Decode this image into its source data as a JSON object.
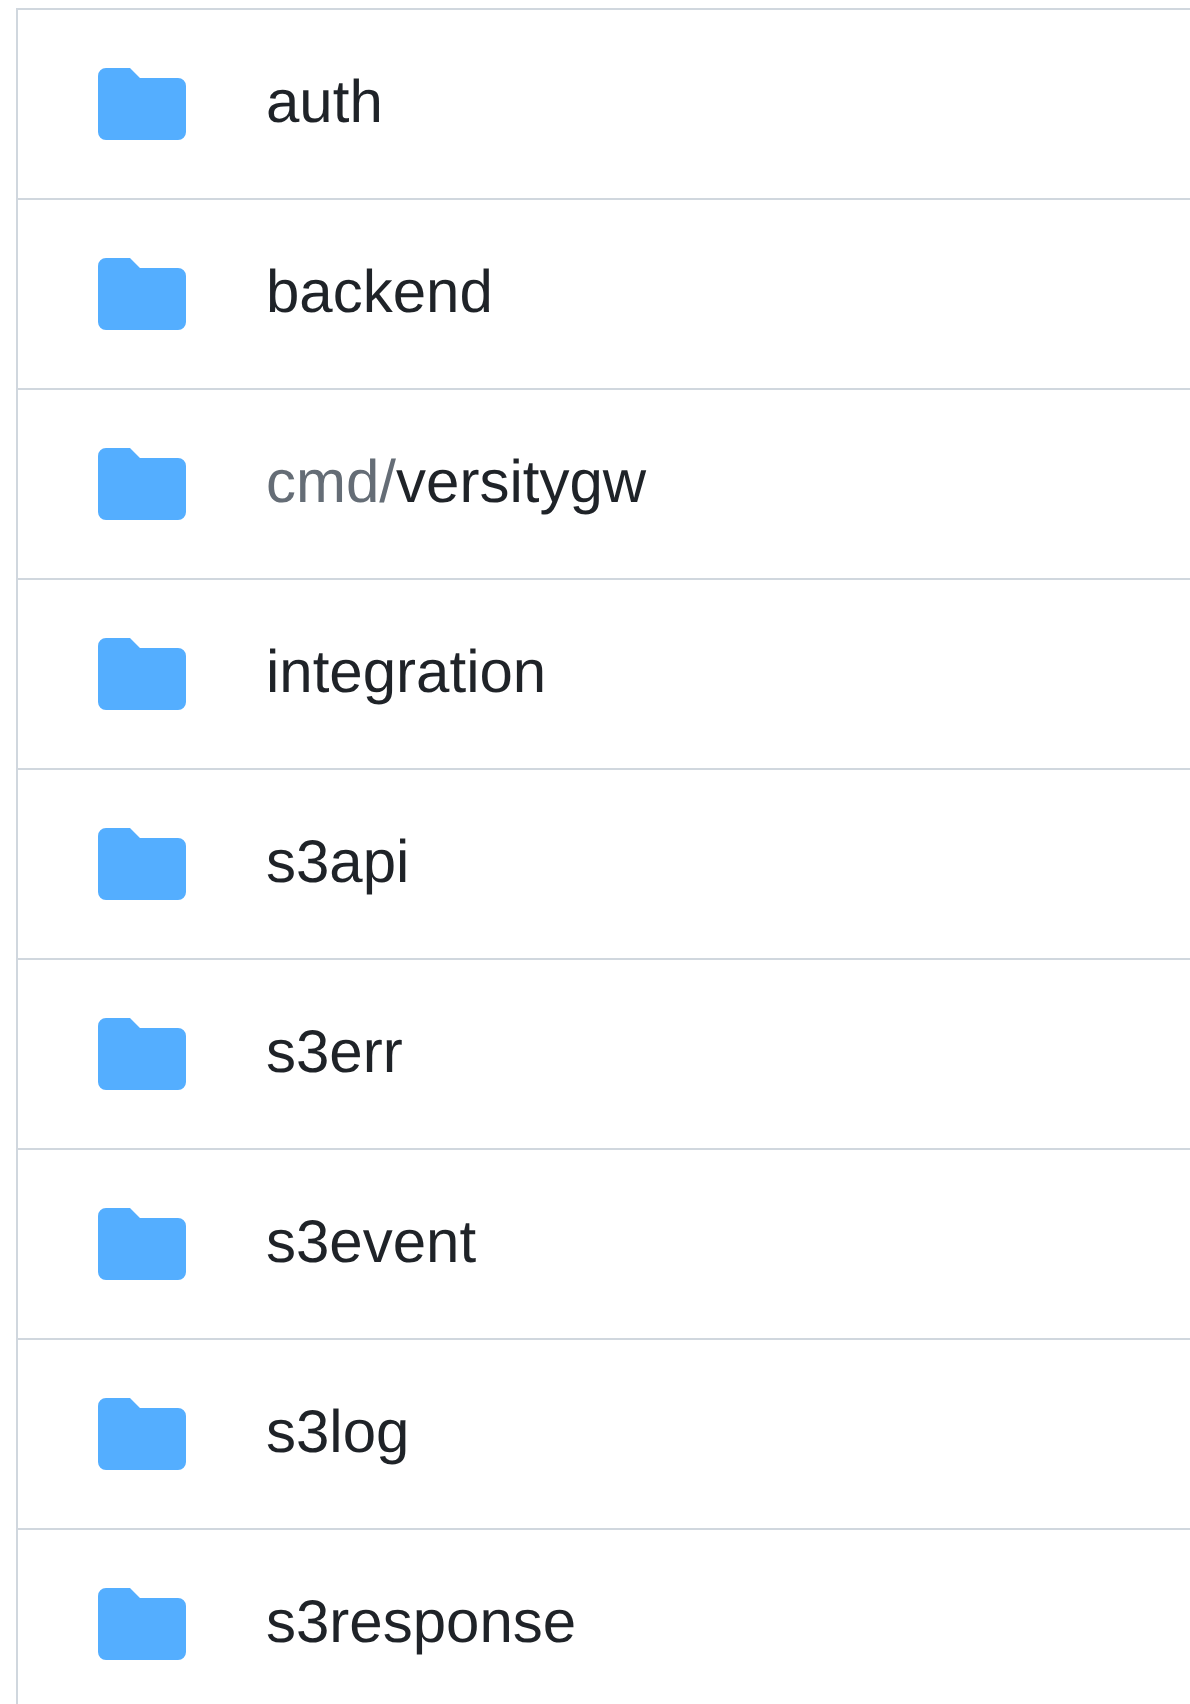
{
  "entries": [
    {
      "kind": "folder",
      "name": "auth"
    },
    {
      "kind": "folder",
      "name": "backend"
    },
    {
      "kind": "folder",
      "prefix": "cmd/",
      "name": "versitygw"
    },
    {
      "kind": "folder",
      "name": "integration"
    },
    {
      "kind": "folder",
      "name": "s3api"
    },
    {
      "kind": "folder",
      "name": "s3err"
    },
    {
      "kind": "folder",
      "name": "s3event"
    },
    {
      "kind": "folder",
      "name": "s3log"
    },
    {
      "kind": "folder",
      "name": "s3response"
    }
  ]
}
